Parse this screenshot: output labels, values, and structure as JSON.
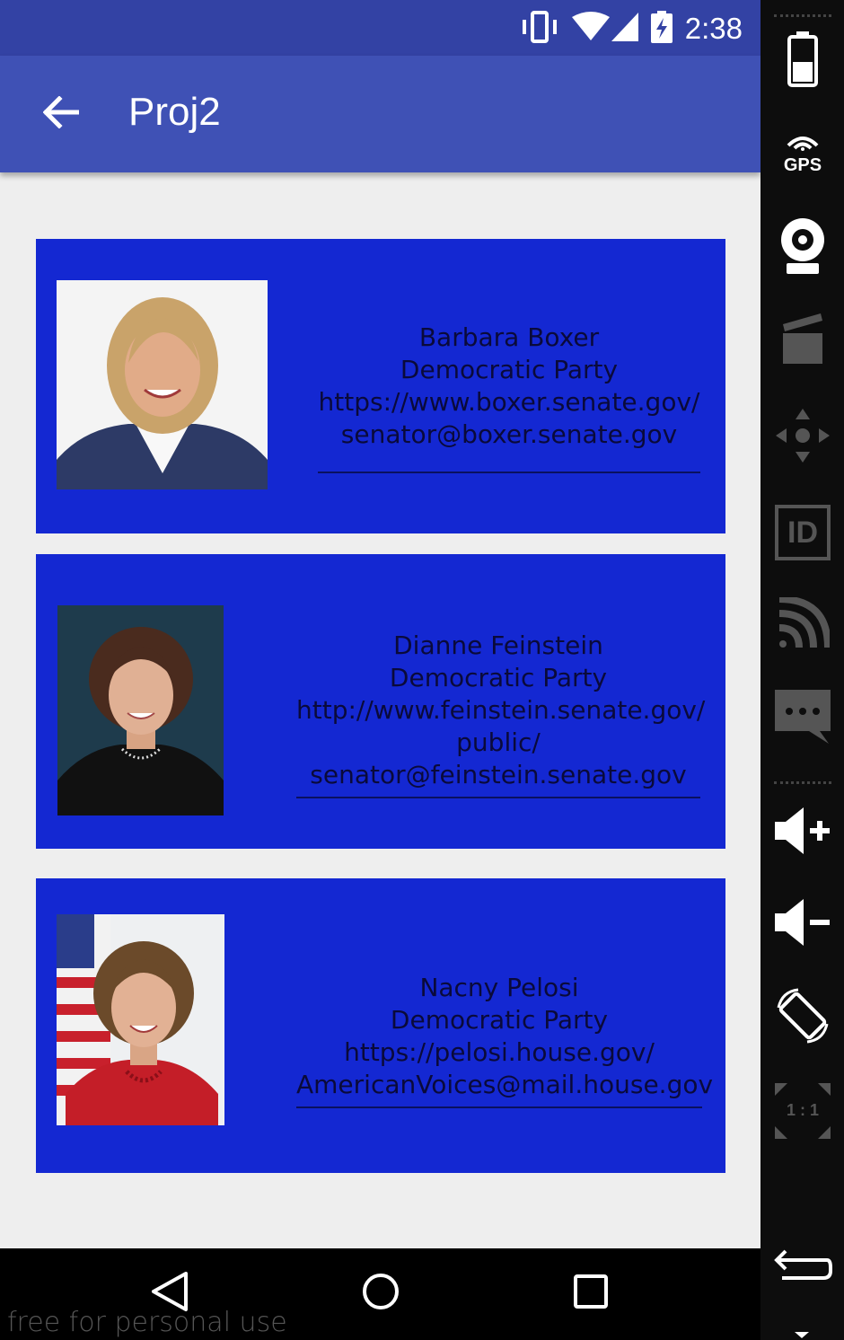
{
  "status_bar": {
    "time": "2:38",
    "icons": [
      "vibrate-icon",
      "wifi-icon",
      "signal-icon",
      "battery-charging-icon"
    ]
  },
  "app_bar": {
    "title": "Proj2",
    "back_icon": "arrow-back-icon"
  },
  "representatives": [
    {
      "name": "Barbara Boxer",
      "party": "Democratic Party",
      "website": "https://www.boxer.senate.gov/",
      "email": "senator@boxer.senate.gov",
      "photo": "portrait-barbara-boxer"
    },
    {
      "name": "Dianne Feinstein",
      "party": "Democratic Party",
      "website_line1": "http://www.feinstein.senate.gov/",
      "website_line2": "public/",
      "email": "senator@feinstein.senate.gov",
      "photo": "portrait-dianne-feinstein"
    },
    {
      "name": "Nacny Pelosi",
      "party": "Democratic Party",
      "website": "https://pelosi.house.gov/",
      "email": "AmericanVoices@mail.house.gov",
      "photo": "portrait-nancy-pelosi"
    }
  ],
  "nav_bar": {
    "buttons": [
      "back-triangle-icon",
      "home-circle-icon",
      "recents-square-icon"
    ]
  },
  "watermark": "free for personal use",
  "emulator_panel": {
    "gps_label": "GPS",
    "id_label": "ID",
    "scale_label": "1 : 1",
    "buttons": [
      "battery-icon",
      "gps-icon",
      "webcam-icon",
      "clapperboard-icon",
      "dpad-icon",
      "id-icon",
      "cast-icon",
      "sms-icon",
      "volume-up-icon",
      "volume-down-icon",
      "rotate-icon",
      "scale-icon",
      "undo-icon"
    ]
  },
  "colors": {
    "status_bar": "#3342a4",
    "app_bar": "#3f51b5",
    "card": "#1428d2",
    "background": "#eeeeee"
  }
}
